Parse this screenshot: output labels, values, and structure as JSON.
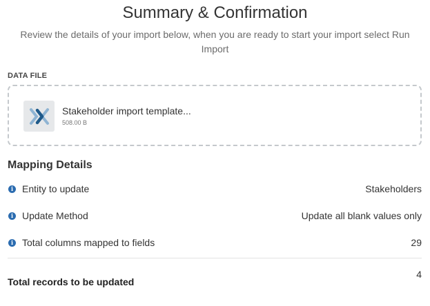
{
  "header": {
    "title": "Summary & Confirmation",
    "subtitle": "Review the details of your import below, when you are ready to start your import select Run Import"
  },
  "data_file": {
    "section_label": "DATA FILE",
    "file_name": "Stakeholder import template...",
    "file_size": "508.00 B",
    "icon": "excel-file-icon"
  },
  "mapping": {
    "title": "Mapping Details",
    "rows": [
      {
        "label": "Entity to update",
        "value": "Stakeholders",
        "icon": "info-icon"
      },
      {
        "label": "Update Method",
        "value": "Update all blank values only",
        "icon": "info-icon"
      },
      {
        "label": "Total columns mapped to fields",
        "value": "29",
        "icon": "info-icon"
      }
    ]
  },
  "total": {
    "label": "Total records to be updated",
    "value": "4"
  },
  "colors": {
    "info_icon": "#2b6cb0",
    "file_icon_dark": "#1f5a8a",
    "file_icon_light": "#8fb4d3"
  }
}
